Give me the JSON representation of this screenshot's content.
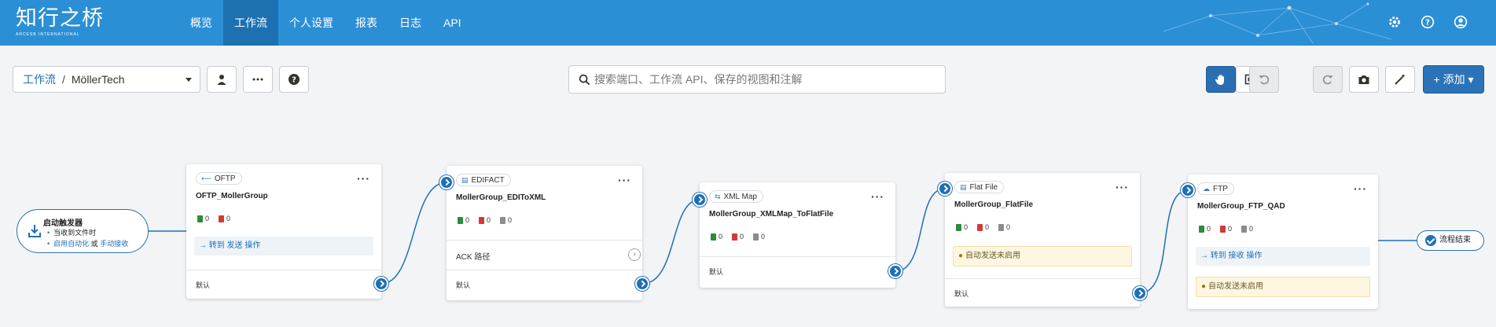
{
  "brand": {
    "name": "知行之桥",
    "tagline": "ARCESB INTERNATIONAL"
  },
  "nav": {
    "items": [
      {
        "label": "概览",
        "active": false
      },
      {
        "label": "工作流",
        "active": true
      },
      {
        "label": "个人设置",
        "active": false
      },
      {
        "label": "报表",
        "active": false
      },
      {
        "label": "日志",
        "active": false
      },
      {
        "label": "API",
        "active": false
      }
    ]
  },
  "top_icons": [
    "gear-icon",
    "help-icon",
    "user-icon"
  ],
  "breadcrumb": {
    "root": "工作流",
    "separator": "/",
    "current": "MöllerTech"
  },
  "search": {
    "placeholder": "搜索端口、工作流 API、保存的视图和注解",
    "value": ""
  },
  "toolbar": {
    "add_label": "+ 添加 ▾",
    "pan_mode_active": true
  },
  "trigger": {
    "title": "启动触发器",
    "lines": [
      {
        "text": "当收到文件时"
      },
      {
        "prefix": "启用自动化",
        "mid": " 或 ",
        "link": "手动接收"
      }
    ]
  },
  "cards": [
    {
      "type": "OFTP",
      "icon": "⟵",
      "name": "OFTP_MollerGroup",
      "counts": [
        "0",
        "0"
      ],
      "action": "→ 转到 发送 操作",
      "output": "默认"
    },
    {
      "type": "EDIFACT",
      "icon": "▤",
      "name": "MollerGroup_EDIToXML",
      "counts": [
        "0",
        "0",
        "0"
      ],
      "ack": "ACK 路径",
      "output": "默认"
    },
    {
      "type": "XML Map",
      "icon": "⇆",
      "name": "MollerGroup_XMLMap_ToFlatFile",
      "counts": [
        "0",
        "0",
        "0"
      ],
      "output": "默认"
    },
    {
      "type": "Flat File",
      "icon": "▤",
      "name": "MollerGroup_FlatFile",
      "counts": [
        "0",
        "0",
        "0"
      ],
      "warning": "自动发送未启用",
      "output": "默认"
    },
    {
      "type": "FTP",
      "icon": "☁",
      "name": "MollerGroup_FTP_QAD",
      "counts": [
        "0",
        "0",
        "0"
      ],
      "action": "→ 转到 接收 操作",
      "warning": "自动发送未启用"
    }
  ],
  "end": {
    "label": "流程结束"
  },
  "colors": {
    "header": "#2b8fd6",
    "active_nav": "#1e71b1",
    "accent": "#1f6fb5",
    "canvas": "#f3f4f6"
  }
}
